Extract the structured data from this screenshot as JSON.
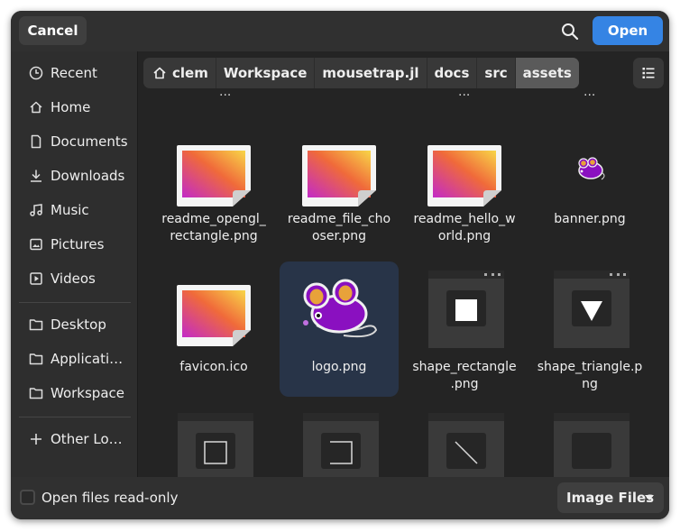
{
  "header": {
    "cancel_label": "Cancel",
    "open_label": "Open"
  },
  "sidebar": {
    "items": [
      {
        "label": "Recent",
        "icon": "clock-icon"
      },
      {
        "label": "Home",
        "icon": "home-icon"
      },
      {
        "label": "Documents",
        "icon": "document-icon"
      },
      {
        "label": "Downloads",
        "icon": "download-icon"
      },
      {
        "label": "Music",
        "icon": "music-icon"
      },
      {
        "label": "Pictures",
        "icon": "image-icon"
      },
      {
        "label": "Videos",
        "icon": "video-icon"
      }
    ],
    "bookmarks": [
      {
        "label": "Desktop",
        "icon": "folder-icon"
      },
      {
        "label": "Applicati…",
        "icon": "folder-icon"
      },
      {
        "label": "Workspace",
        "icon": "folder-icon"
      }
    ],
    "other": {
      "label": "Other Lo…",
      "icon": "plus-icon"
    }
  },
  "pathbar": {
    "crumbs": [
      "clem",
      "Workspace",
      "mousetrap.jl",
      "docs",
      "src",
      "assets"
    ]
  },
  "files": [
    {
      "name": "readme_opengl_\nrectangle.png",
      "type": "gradient-image"
    },
    {
      "name": "readme_file_cho\noser.png",
      "type": "gradient-image"
    },
    {
      "name": "readme_hello_w\norld.png",
      "type": "gradient-image"
    },
    {
      "name": "banner.png",
      "type": "mouse-small"
    },
    {
      "name": "favicon.ico",
      "type": "gradient-image"
    },
    {
      "name": "logo.png",
      "type": "mouse-large",
      "selected": true
    },
    {
      "name": "shape_rectangle\n.png",
      "type": "window-rectangle"
    },
    {
      "name": "shape_triangle.p\nng",
      "type": "window-triangle"
    }
  ],
  "colors": {
    "accent": "#3584e4",
    "selected_bg": "#283448",
    "dialog_bg": "#242424"
  },
  "footer": {
    "readonly_label": "Open files read-only",
    "filter_label": "Image Files"
  }
}
